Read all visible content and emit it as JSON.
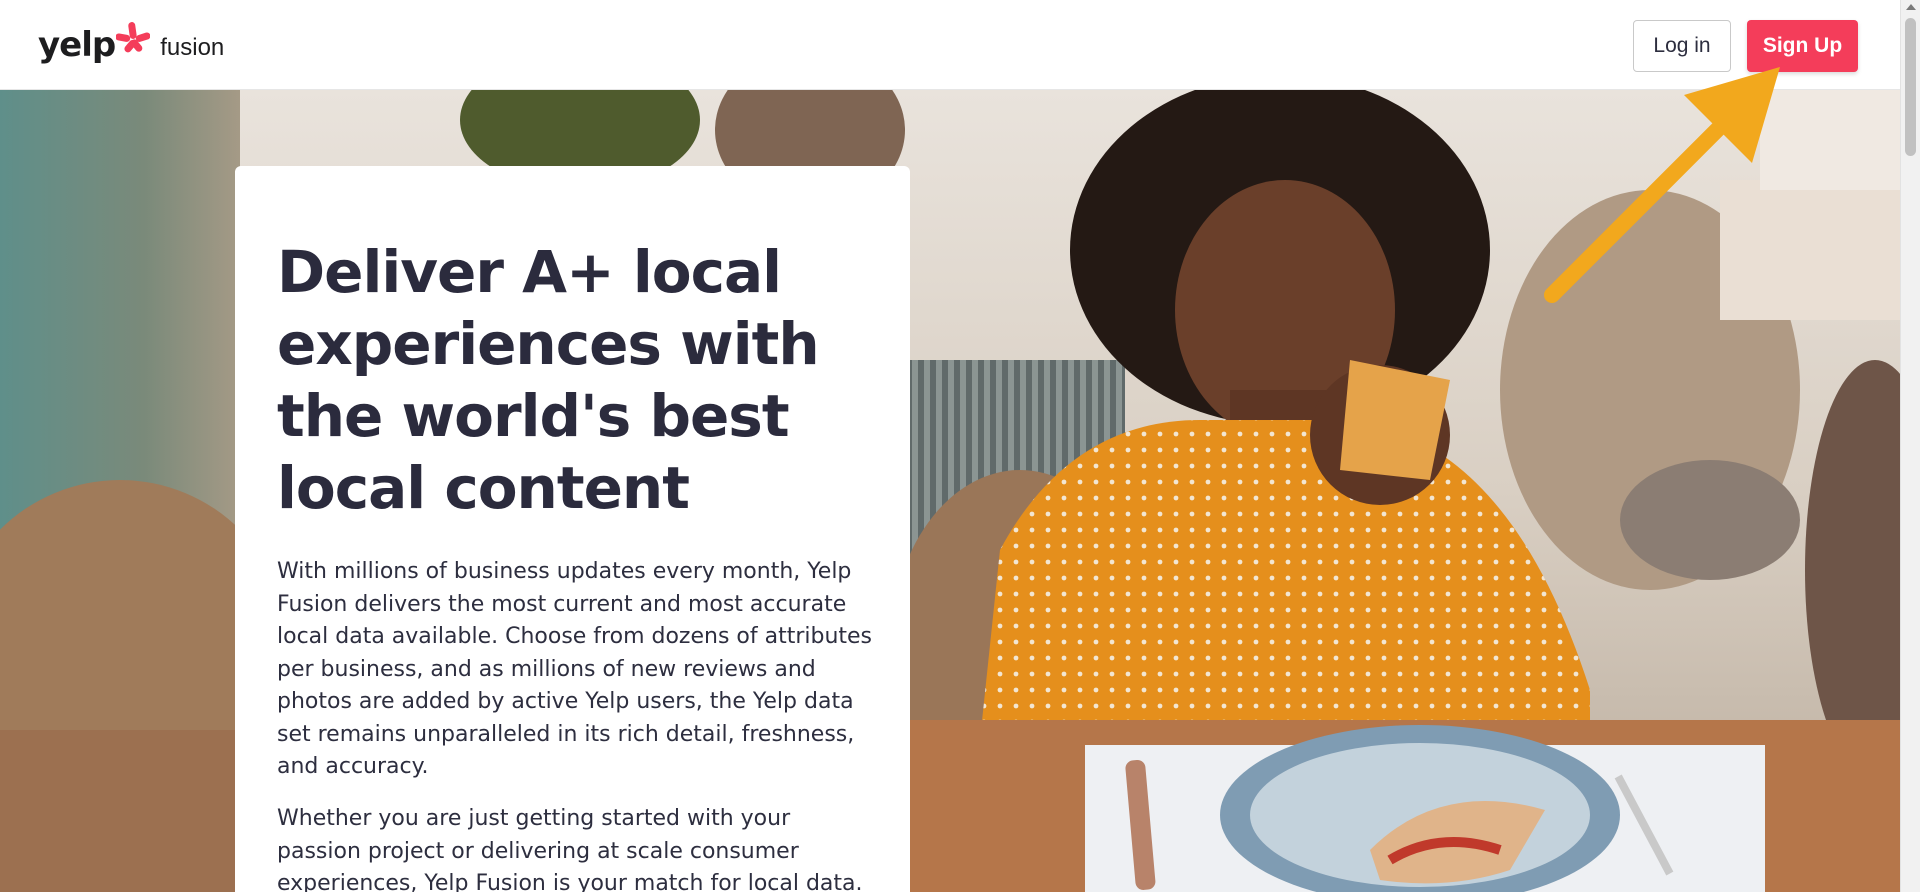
{
  "header": {
    "logo_text": "yelp",
    "logo_suffix": "fusion",
    "login_label": "Log in",
    "signup_label": "Sign Up"
  },
  "hero": {
    "title": "Deliver A+ local experiences with the world's best local content",
    "paragraph1": "With millions of business updates every month, Yelp Fusion delivers the most current and most accurate local data available. Choose from dozens of attributes per business, and as millions of new reviews and photos are added by active Yelp users, the Yelp data set remains unparalleled in its rich detail, freshness, and accuracy.",
    "paragraph2": "Whether you are just getting started with your passion project or delivering at scale consumer experiences, Yelp Fusion is your match for local data."
  },
  "colors": {
    "brand_red": "#f43d5a",
    "annotation_arrow": "#f2a81d"
  },
  "icons": [
    "yelp-burst-icon",
    "annotation-arrow-icon"
  ]
}
